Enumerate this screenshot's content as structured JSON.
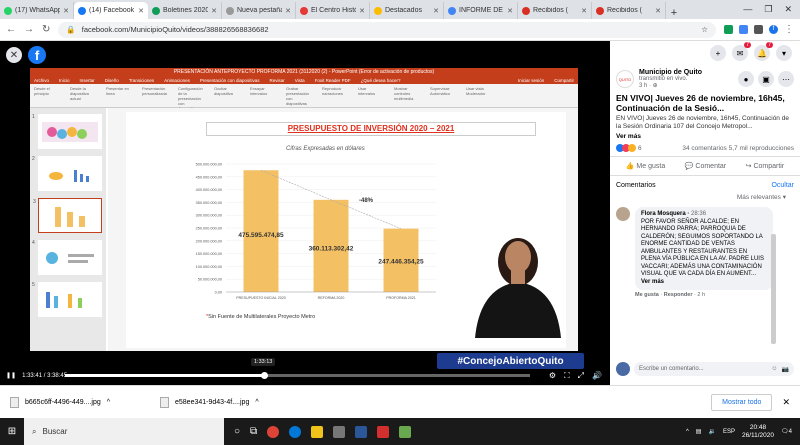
{
  "tabs": [
    {
      "label": "(17) WhatsApp",
      "color": "#25d366",
      "active": false
    },
    {
      "label": "(14) Facebook",
      "color": "#1877f2",
      "active": true
    },
    {
      "label": "Boletines 2020",
      "color": "#0f9d58",
      "active": false
    },
    {
      "label": "Nueva pestaña",
      "color": "#999999",
      "active": false
    },
    {
      "label": "El Centro Histórico",
      "color": "#e53935",
      "active": false
    },
    {
      "label": "Destacados",
      "color": "#fbbc04",
      "active": false
    },
    {
      "label": "INFORME DE",
      "color": "#4285f4",
      "active": false
    },
    {
      "label": "Recibidos (",
      "color": "#d93025",
      "active": false
    },
    {
      "label": "Recibidos (",
      "color": "#d93025",
      "active": false
    }
  ],
  "browser": {
    "url": "facebook.com/MunicipioQuito/videos/388826568836682",
    "new_tab": "+",
    "minimize": "—",
    "maximize": "❐",
    "close": "✕",
    "profile_initial": "f"
  },
  "ppt": {
    "window_title": "PRESENTACIÓN ANTEPROYECTO PROFORMA 2021 (3112020 (2) - PowerPoint (Error de activación de productos)",
    "menu": [
      "Archivo",
      "Inicio",
      "Insertar",
      "Diseño",
      "Transiciones",
      "Animaciones",
      "Presentación con diapositivas",
      "Revisar",
      "Vista",
      "Foxit Reader PDF",
      "¿Qué desea hacer?"
    ],
    "menu_right": [
      "Iniciar sesión",
      "Compartir"
    ],
    "ribbon": [
      "Desde el principio",
      "Desde la diapositiva actual",
      "Presentar en línea",
      "Presentación personalizada",
      "Configuración de la presentación con diapositivas",
      "Ocultar diapositiva",
      "Ensayar intervalos",
      "Grabar presentación con diapositivas",
      "Reproducir narraciones",
      "Usar intervalos",
      "Mostrar controles multimedia",
      "Supervisar: Automático",
      "Usar vista Moderador"
    ],
    "thumb_numbers": [
      "1",
      "2",
      "3",
      "4",
      "5"
    ],
    "slide_title": "PRESUPUESTO DE INVERSIÓN 2020 – 2021",
    "slide_subtitle": "Cifras Expresadas en dólares",
    "footnote_star": "*",
    "footnote": "Sin Fuente de Multilaterales Proyecto Metro",
    "change_label": "-48%"
  },
  "chart_data": {
    "type": "bar",
    "categories": [
      "PRESUPUESTO INICIAL 2020",
      "REFORMA 2020",
      "PROFORMA 2021"
    ],
    "values": [
      475595474.85,
      360113302.42,
      247446354.25
    ],
    "value_labels": [
      "475.595.474,85",
      "360.113.302,42",
      "247.446.354,25"
    ],
    "y_ticks": [
      "0,00",
      "50.000.000,00",
      "100.000.000,00",
      "150.000.000,00",
      "200.000.000,00",
      "250.000.000,00",
      "300.000.000,00",
      "350.000.000,00",
      "400.000.000,00",
      "450.000.000,00",
      "500.000.000,00"
    ],
    "ylim": [
      0,
      500000000
    ],
    "title": "PRESUPUESTO DE INVERSIÓN 2020 – 2021",
    "bar_color": "#f4c064"
  },
  "video": {
    "hashtag": "#ConcejoAbiertoQuito",
    "time": "1:33:41 / 3:38:45",
    "tooltip_time": "1:33:13",
    "progress_fraction": 0.428
  },
  "side": {
    "page_name": "Municipio de Quito",
    "page_action": "transmitió en vivo.",
    "page_meta": "3 h · ⊕",
    "video_title": "EN VIVO| Jueves 26 de noviembre, 16h45, Continuación de la Sesió...",
    "video_desc": "EN VIVO| Jueves 26 de noviembre, 16h45, Continuación de la Sesión Ordinaria 107 del Concejo Metropol...",
    "see_more": "Ver más",
    "reaction_counts": "34 comentarios  5,7 mil reproducciones",
    "reaction_number": "6",
    "actions": [
      "Me gusta",
      "Comentar",
      "Compartir"
    ],
    "comments_label": "Comentarios",
    "hide_label": "Ocultar",
    "relevance": "Más relevantes ▾",
    "comment": {
      "author": "Flora Mosquera",
      "time": "28:36",
      "text": "POR FAVOR SEÑOR ALCALDE; EN HERNANDO PARRA; PARROQUIA DE CALDERÓN; SEGUIMOS SOPORTANDO LA ENORME CANTIDAD DE VENTAS AMBULANTES Y RESTAURANTES EN PLENA VÍA PÚBLICA EN LA AV. PADRE LUIS VACCARI; ADEMÁS UNA CONTAMINACIÓN VISUAL QUE VA CADA DÍA EN AUMENT...",
      "see_more": "Ver más",
      "like": "Me gusta",
      "reply": "Responder",
      "age": "2 h"
    },
    "write_placeholder": "Escribe un comentario...",
    "badge_1": "7",
    "badge_2": "7"
  },
  "downloads": {
    "items": [
      "b665c6ff-4496-449....jpg",
      "e58ee341-9d43-4f....jpg"
    ],
    "show_all": "Mostrar todo"
  },
  "taskbar": {
    "search": "Buscar",
    "lang": "ESP",
    "time": "20:48",
    "date": "26/11/2020",
    "notif": "4"
  }
}
